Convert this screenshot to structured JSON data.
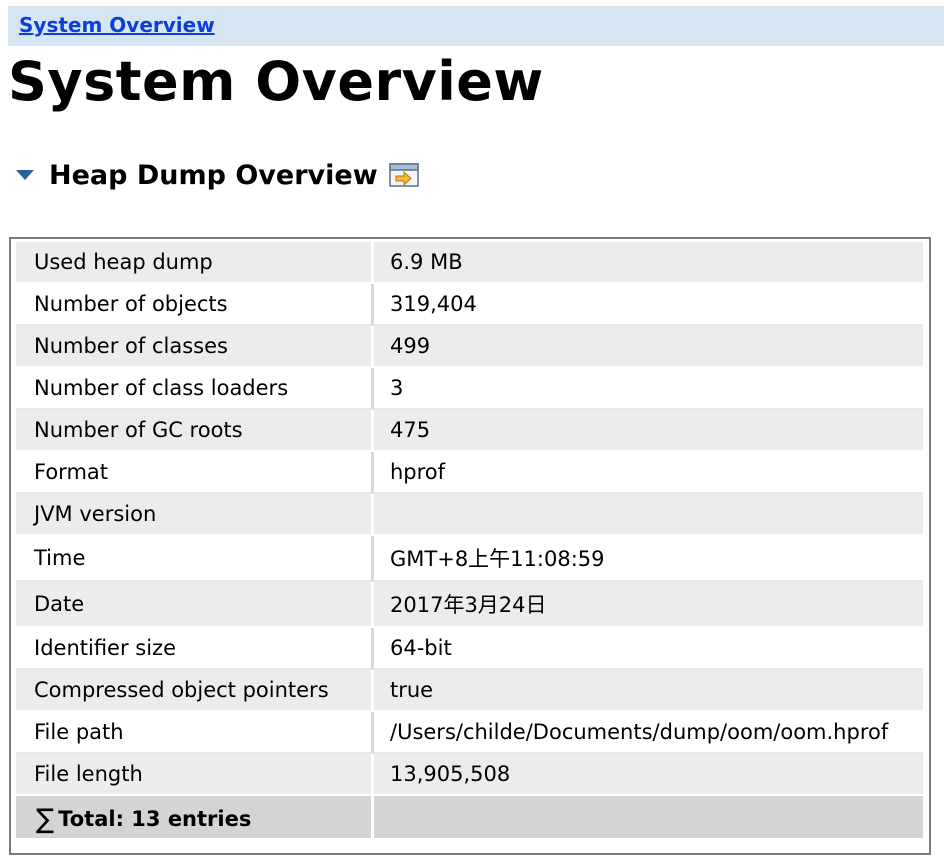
{
  "breadcrumb": {
    "link": "System Overview"
  },
  "page_title": "System Overview",
  "section": {
    "title": "Heap Dump Overview"
  },
  "icons": {
    "toggle": "triangle-down-icon",
    "details": "details-window-icon",
    "total": "sigma-icon"
  },
  "colors": {
    "breadcrumb_bg": "#d6e5f2",
    "link": "#0b3fd8",
    "row_shaded": "#ececec",
    "total_row": "#d4d4d4"
  },
  "table": {
    "rows": [
      {
        "name": "Used heap dump",
        "value": "6.9 MB"
      },
      {
        "name": "Number of objects",
        "value": "319,404"
      },
      {
        "name": "Number of classes",
        "value": "499"
      },
      {
        "name": "Number of class loaders",
        "value": "3"
      },
      {
        "name": "Number of GC roots",
        "value": "475"
      },
      {
        "name": "Format",
        "value": "hprof"
      },
      {
        "name": "JVM version",
        "value": ""
      },
      {
        "name": "Time",
        "value": "GMT+8上午11:08:59"
      },
      {
        "name": "Date",
        "value": "2017年3月24日"
      },
      {
        "name": "Identifier size",
        "value": "64-bit"
      },
      {
        "name": "Compressed object pointers",
        "value": "true"
      },
      {
        "name": "File path",
        "value": "/Users/childe/Documents/dump/oom/oom.hprof"
      },
      {
        "name": "File length",
        "value": "13,905,508"
      }
    ],
    "total_label": "Total: 13 entries",
    "total_symbol": "∑"
  }
}
